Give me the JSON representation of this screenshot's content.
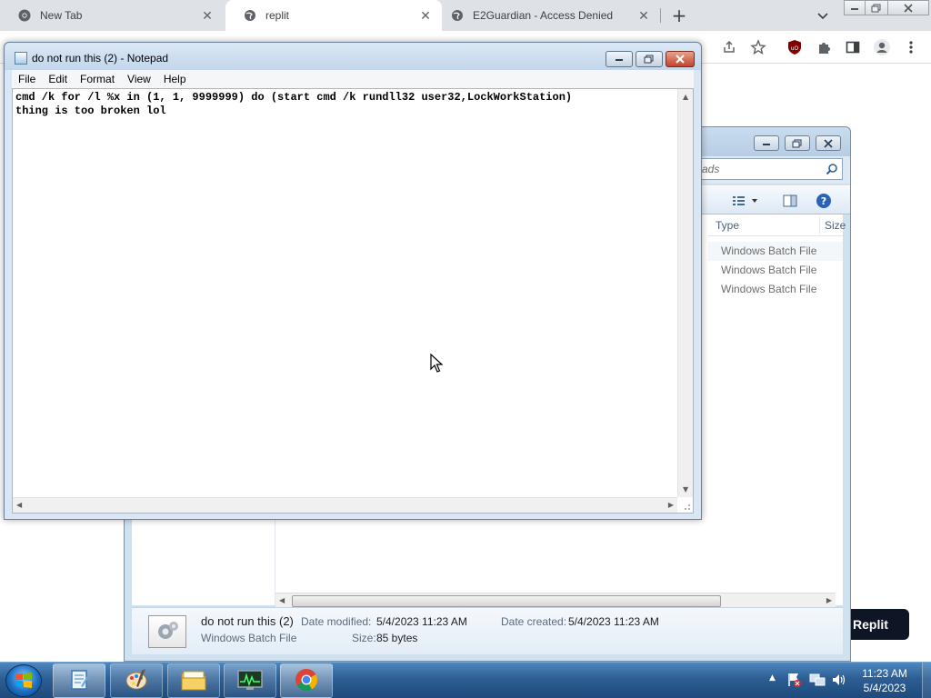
{
  "browser": {
    "tabs": [
      {
        "label": "New Tab",
        "active": false
      },
      {
        "label": "replit",
        "active": true
      },
      {
        "label": "E2Guardian - Access Denied",
        "active": false
      }
    ],
    "new_tab": "+",
    "replit_button": "Replit"
  },
  "notepad": {
    "title": "do not run this (2) - Notepad",
    "menu": [
      "File",
      "Edit",
      "Format",
      "View",
      "Help"
    ],
    "lines": [
      "cmd /k for /l %x in (1, 1, 9999999) do (start cmd /k rundll32 user32,LockWorkStation)",
      "thing is too broken lol"
    ]
  },
  "explorer": {
    "search_placeholder": "ads",
    "columns": {
      "type": "Type",
      "size": "Size"
    },
    "rows": [
      "Windows Batch File",
      "Windows Batch File",
      "Windows Batch File"
    ],
    "details": {
      "name": "do not run this (2)",
      "type": "Windows Batch File",
      "date_modified_label": "Date modified:",
      "date_modified": "5/4/2023 11:23 AM",
      "date_created_label": "Date created:",
      "date_created": "5/4/2023 11:23 AM",
      "size_label": "Size:",
      "size": "85 bytes"
    }
  },
  "taskbar": {
    "apps": [
      "notepad-icon",
      "paint-icon",
      "file-explorer-icon",
      "task-manager-icon",
      "chrome-icon"
    ],
    "time": "11:23 AM",
    "date": "5/4/2023"
  },
  "colors": {
    "taskbar": "#2d5e93",
    "notepad_frame": "#d9e7f5",
    "replit_btn": "#0e1525"
  }
}
